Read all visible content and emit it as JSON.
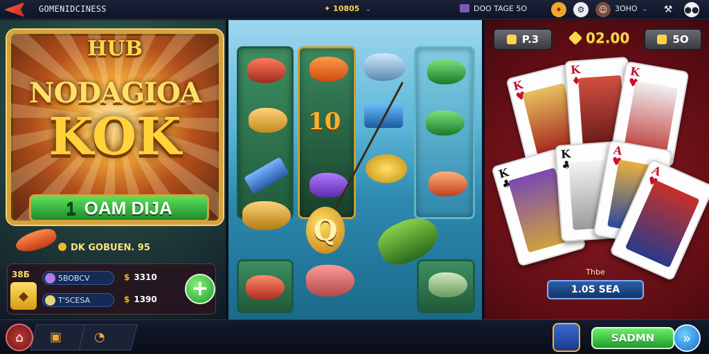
{
  "topbar": {
    "title": "GOMENIDCINESS",
    "coins": "10805",
    "date_text": "DOO TAGE 5O",
    "score": "3OHO",
    "chevron": "⌄"
  },
  "poster": {
    "hub": "HUB",
    "line1": "NODAGIOA",
    "line2": "KOK",
    "button_label": "OAM DIJA",
    "button_prefix": "1",
    "coin_text": "DK GOBUEN. 95"
  },
  "stats": {
    "left_label": "38Б",
    "rows": [
      {
        "pill": "5BOBCV",
        "value": "3310",
        "sym": "$"
      },
      {
        "pill": "T'SCESA",
        "value": "1390",
        "sym": "$"
      }
    ],
    "plus": "+"
  },
  "reels": {
    "ten": "10",
    "q": "Q"
  },
  "cards_panel": {
    "chip_left": "P.3",
    "bank": "02.00",
    "chip_right": "5O",
    "sea_label": "1.0S SEA",
    "sea_top": "Thbe",
    "cards": [
      {
        "rank": "K",
        "suit": "♥",
        "color": "#c8102e"
      },
      {
        "rank": "K",
        "suit": "♦",
        "color": "#c8102e"
      },
      {
        "rank": "K",
        "suit": "♥",
        "color": "#c8102e"
      },
      {
        "rank": "K",
        "suit": "♣",
        "color": "#111111"
      },
      {
        "rank": "K",
        "suit": "♣",
        "color": "#111111"
      },
      {
        "rank": "A",
        "suit": "♥",
        "color": "#c8102e"
      },
      {
        "rank": "A",
        "suit": "♥",
        "color": "#c8102e"
      }
    ]
  },
  "bottombar": {
    "cta_label": "SADMN",
    "arrow": "»"
  }
}
